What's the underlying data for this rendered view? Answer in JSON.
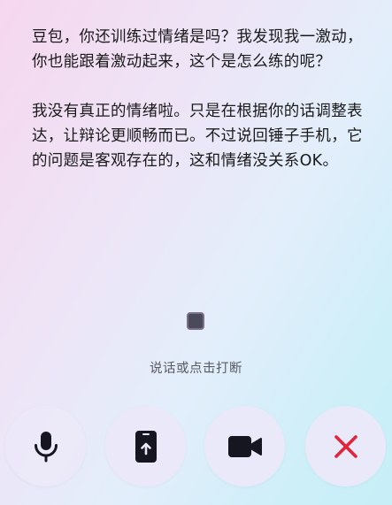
{
  "conversation": {
    "messages": [
      {
        "text": "豆包，你还训练过情绪是吗？我发现我一激动，你也能跟着激动起来，这个是怎么练的呢？"
      },
      {
        "text": "我没有真正的情绪啦。只是在根据你的话调整表达，让辩论更顺畅而已。不过说回锤子手机，它的问题是客观存在的，这和情绪没关系OK。"
      }
    ]
  },
  "status": {
    "hint": "说话或点击打断"
  },
  "controls": {
    "mic_icon": "microphone-icon",
    "share_icon": "phone-upload-icon",
    "camera_icon": "video-camera-icon",
    "close_icon": "close-x-icon",
    "close_color": "#e0243a"
  }
}
